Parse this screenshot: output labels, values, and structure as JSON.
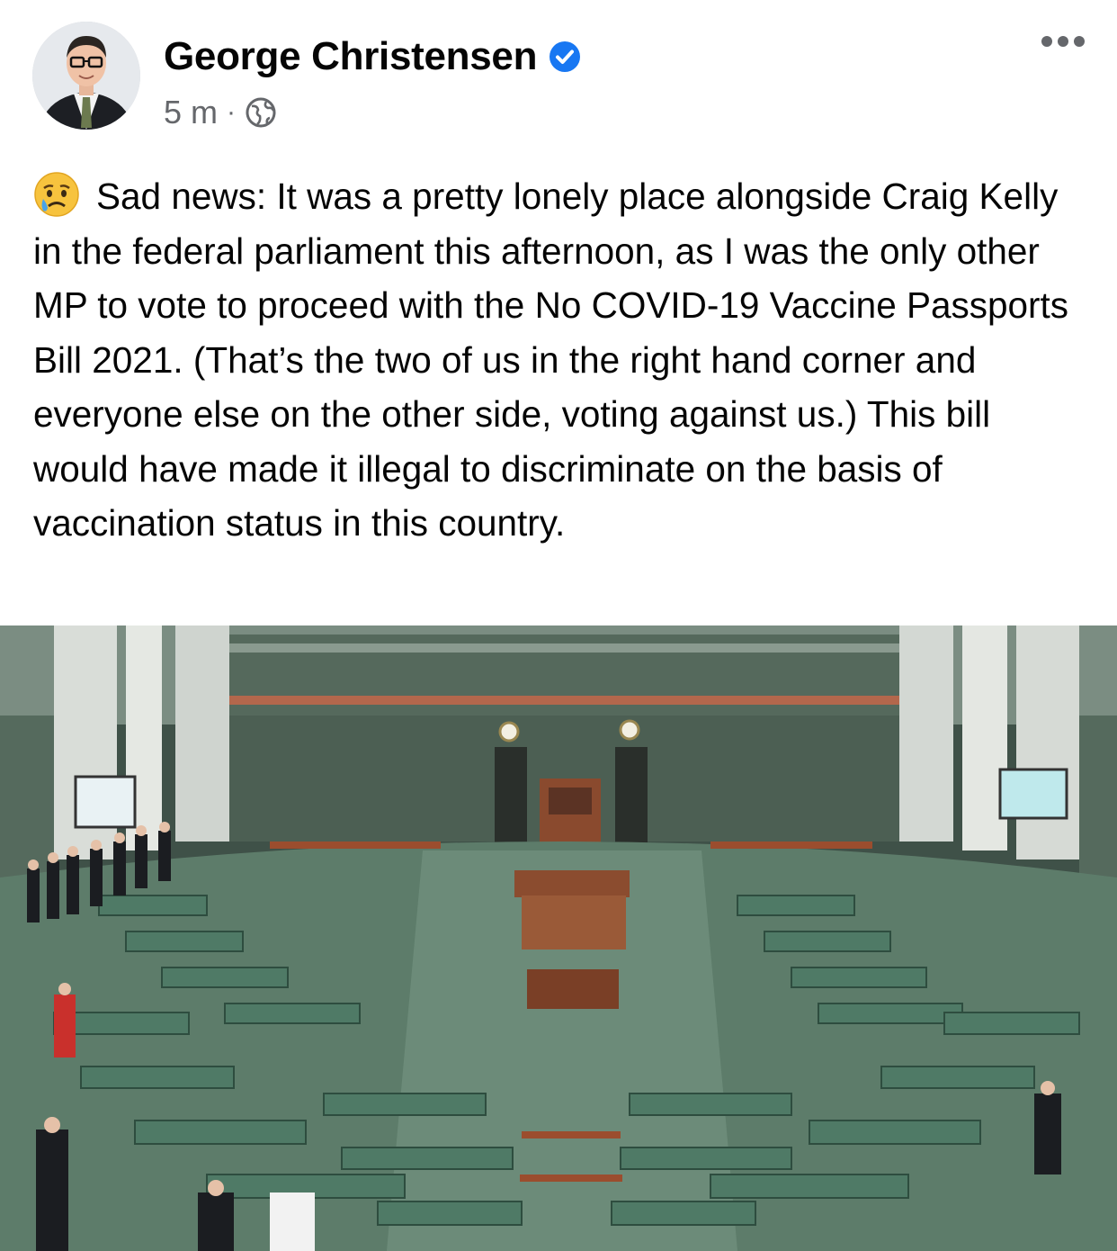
{
  "post": {
    "author": {
      "name": "George Christensen",
      "verified": true
    },
    "timestamp": "5 m",
    "separator": "·",
    "audience_icon": "globe-icon",
    "reaction_emoji": "crying-face-emoji",
    "text": "Sad news: It was a pretty lonely place alongside Craig Kelly in the federal parliament this afternoon, as I was the only other MP to vote to proceed with the No COVID-19 Vaccine Passports Bill 2021. (That’s the two of us in the right hand corner and everyone else on the other side, voting against us.) This bill would have made it illegal to discriminate on the basis of vaccination status in this country.",
    "image": "photo-house-of-representatives-chamber"
  },
  "colors": {
    "verified_blue": "#1877f2",
    "meta_gray": "#65676b",
    "chamber_green": "#5d7c6a"
  }
}
